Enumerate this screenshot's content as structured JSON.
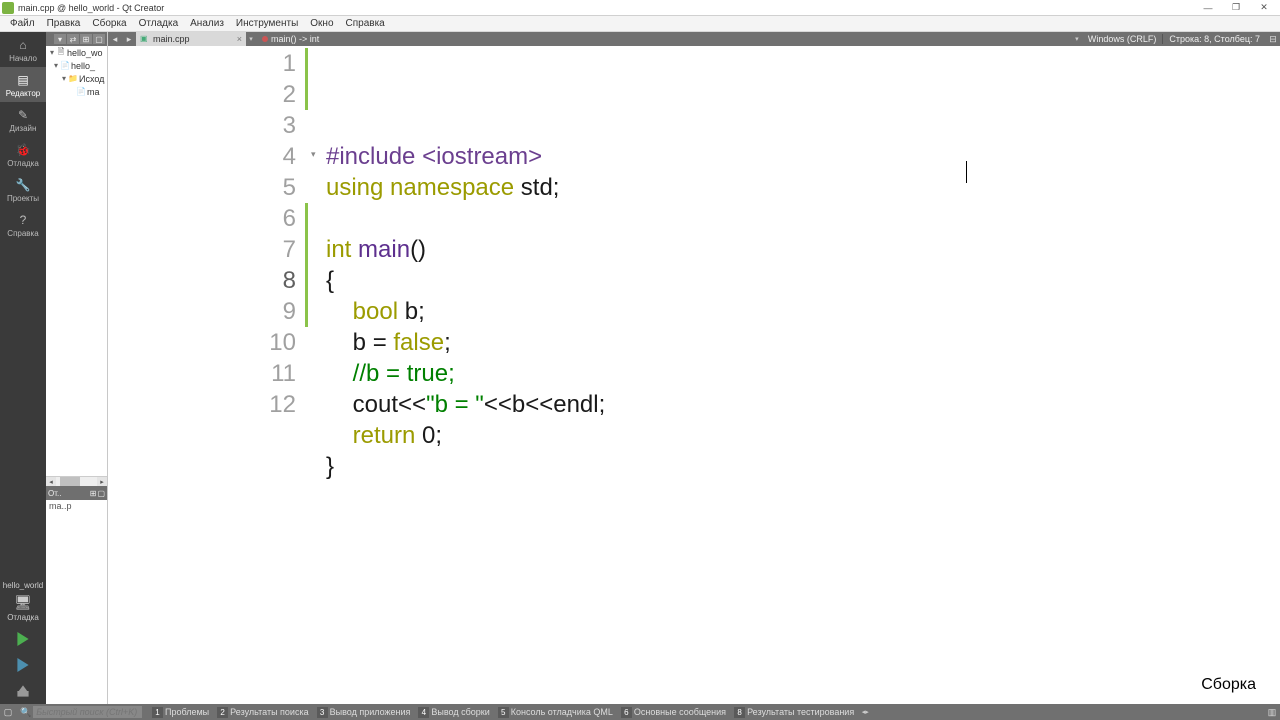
{
  "window": {
    "title": "main.cpp @ hello_world - Qt Creator"
  },
  "menubar": [
    "Файл",
    "Правка",
    "Сборка",
    "Отладка",
    "Анализ",
    "Инструменты",
    "Окно",
    "Справка"
  ],
  "modes": [
    {
      "label": "Начало",
      "icon": "⌂"
    },
    {
      "label": "Редактор",
      "icon": "▤",
      "active": true
    },
    {
      "label": "Дизайн",
      "icon": "✎"
    },
    {
      "label": "Отладка",
      "icon": "🐞"
    },
    {
      "label": "Проекты",
      "icon": "🔧"
    },
    {
      "label": "Справка",
      "icon": "?"
    }
  ],
  "target": {
    "project": "hello_world",
    "config": "Отладка"
  },
  "tree": {
    "root": "hello_wo",
    "items": [
      {
        "depth": 0,
        "arrow": "▾",
        "icon": "📄",
        "label": "hello_"
      },
      {
        "depth": 1,
        "arrow": "▾",
        "icon": "📁",
        "label": "Исход"
      },
      {
        "depth": 2,
        "arrow": "",
        "icon": "📄",
        "label": "ma"
      }
    ]
  },
  "outline": {
    "toolbar": "От..",
    "item": "ma..p"
  },
  "tabs": {
    "file": "main.cpp",
    "crumb": "main() -> int"
  },
  "editor_status": {
    "encoding": "Windows (CRLF)",
    "pos": "Строка: 8, Столбец: 7"
  },
  "code_lines": [
    {
      "n": 1,
      "changed": true,
      "tokens": [
        {
          "c": "pre",
          "t": "#include"
        },
        {
          "c": "op",
          "t": " "
        },
        {
          "c": "pre",
          "t": "<iostream>"
        }
      ]
    },
    {
      "n": 2,
      "changed": true,
      "tokens": [
        {
          "c": "kw",
          "t": "using"
        },
        {
          "c": "op",
          "t": " "
        },
        {
          "c": "kw",
          "t": "namespace"
        },
        {
          "c": "op",
          "t": " std;"
        }
      ]
    },
    {
      "n": 3,
      "changed": false,
      "tokens": []
    },
    {
      "n": 4,
      "changed": false,
      "fold": true,
      "tokens": [
        {
          "c": "kw",
          "t": "int"
        },
        {
          "c": "op",
          "t": " "
        },
        {
          "c": "fn",
          "t": "main"
        },
        {
          "c": "op",
          "t": "()"
        }
      ]
    },
    {
      "n": 5,
      "changed": false,
      "tokens": [
        {
          "c": "op",
          "t": "{"
        }
      ]
    },
    {
      "n": 6,
      "changed": true,
      "tokens": [
        {
          "c": "op",
          "t": "    "
        },
        {
          "c": "kw",
          "t": "bool"
        },
        {
          "c": "op",
          "t": " b;"
        }
      ]
    },
    {
      "n": 7,
      "changed": true,
      "tokens": [
        {
          "c": "op",
          "t": "    b = "
        },
        {
          "c": "kw",
          "t": "false"
        },
        {
          "c": "op",
          "t": ";"
        }
      ]
    },
    {
      "n": 8,
      "changed": true,
      "current": true,
      "tokens": [
        {
          "c": "op",
          "t": "    "
        },
        {
          "c": "com",
          "t": "//b = true;"
        }
      ]
    },
    {
      "n": 9,
      "changed": true,
      "tokens": [
        {
          "c": "op",
          "t": "    cout<<"
        },
        {
          "c": "str",
          "t": "\"b = \""
        },
        {
          "c": "op",
          "t": "<<b<<endl;"
        }
      ]
    },
    {
      "n": 10,
      "changed": false,
      "tokens": [
        {
          "c": "op",
          "t": "    "
        },
        {
          "c": "kw",
          "t": "return"
        },
        {
          "c": "op",
          "t": " 0;"
        }
      ]
    },
    {
      "n": 11,
      "changed": false,
      "tokens": [
        {
          "c": "op",
          "t": "}"
        }
      ]
    },
    {
      "n": 12,
      "changed": false,
      "tokens": []
    }
  ],
  "statusbar": {
    "search_placeholder": "Быстрый поиск (Ctrl+K)",
    "panes": [
      {
        "n": "1",
        "label": "Проблемы"
      },
      {
        "n": "2",
        "label": "Результаты поиска"
      },
      {
        "n": "3",
        "label": "Вывод приложения"
      },
      {
        "n": "4",
        "label": "Вывод сборки"
      },
      {
        "n": "5",
        "label": "Консоль отладчика QML"
      },
      {
        "n": "6",
        "label": "Основные сообщения"
      },
      {
        "n": "8",
        "label": "Результаты тестирования"
      }
    ],
    "build": "Сборка"
  }
}
